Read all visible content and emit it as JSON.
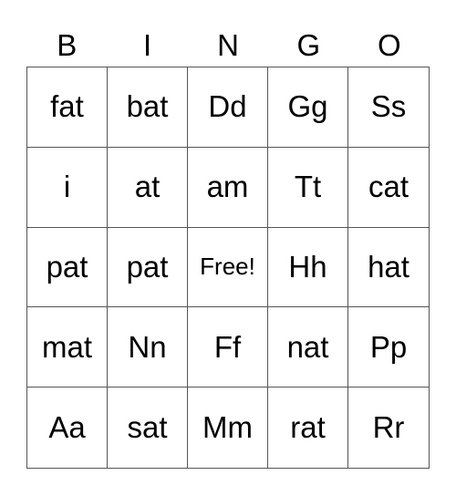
{
  "header": [
    "B",
    "I",
    "N",
    "G",
    "O"
  ],
  "cells": [
    [
      "fat",
      "bat",
      "Dd",
      "Gg",
      "Ss"
    ],
    [
      "i",
      "at",
      "am",
      "Tt",
      "cat"
    ],
    [
      "pat",
      "pat",
      "Free!",
      "Hh",
      "hat"
    ],
    [
      "mat",
      "Nn",
      "Ff",
      "nat",
      "Pp"
    ],
    [
      "Aa",
      "sat",
      "Mm",
      "rat",
      "Rr"
    ]
  ],
  "free_label": "Free!"
}
